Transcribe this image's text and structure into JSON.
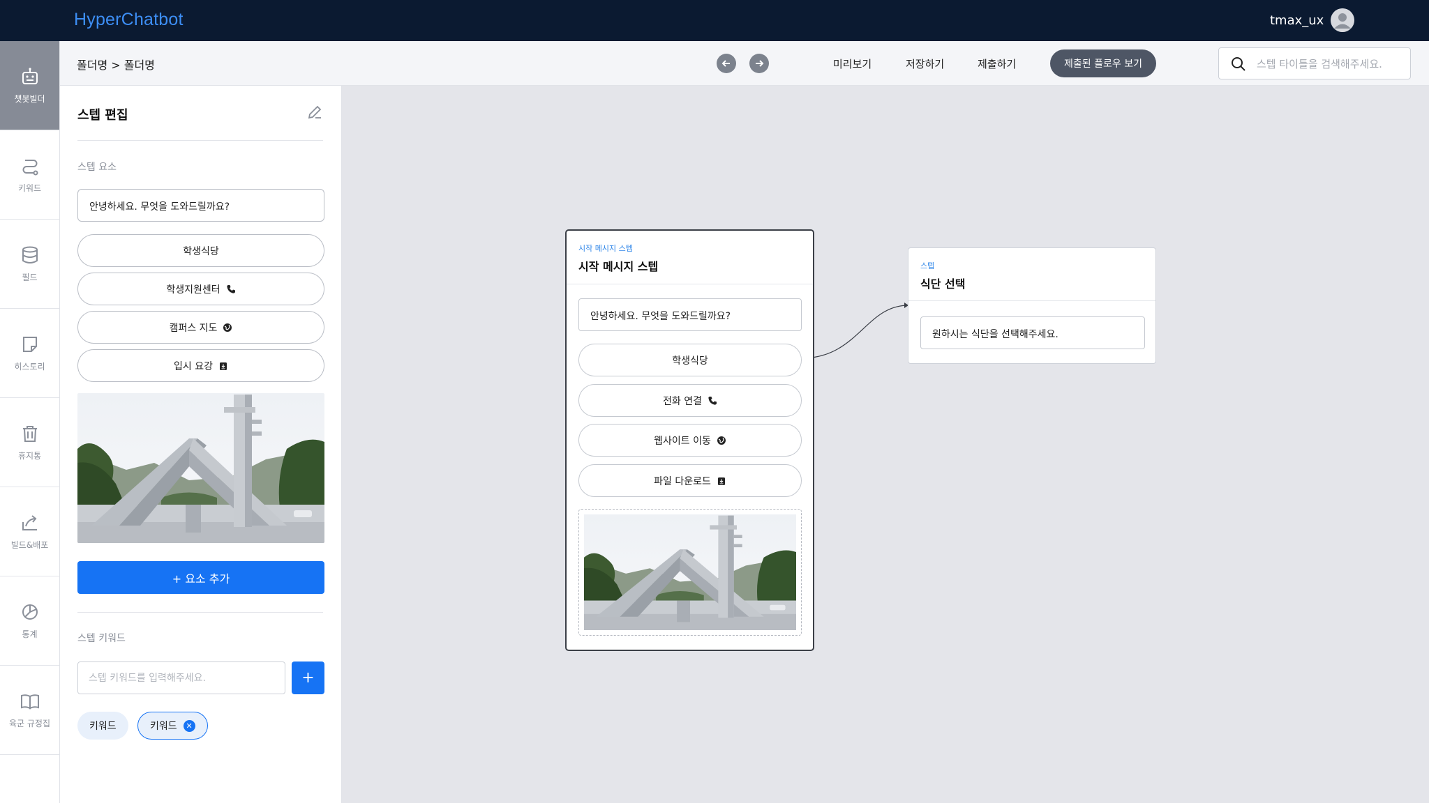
{
  "app": {
    "title": "HyperChatbot",
    "username": "tmax_ux"
  },
  "rail": {
    "items": [
      {
        "label": "챗봇빌더",
        "icon": "robot-icon",
        "active": true
      },
      {
        "label": "키워드",
        "icon": "route-icon",
        "active": false
      },
      {
        "label": "필드",
        "icon": "database-icon",
        "active": false
      },
      {
        "label": "히스토리",
        "icon": "note-icon",
        "active": false
      },
      {
        "label": "휴지통",
        "icon": "trash-icon",
        "active": false
      },
      {
        "label": "빌드&배포",
        "icon": "share-icon",
        "active": false
      },
      {
        "label": "통계",
        "icon": "pie-chart-icon",
        "active": false
      },
      {
        "label": "육군 규정집",
        "icon": "book-icon",
        "active": false
      }
    ]
  },
  "subheader": {
    "breadcrumb": "폴더명 > 폴더명",
    "preview": "미리보기",
    "save": "저장하기",
    "submit": "제출하기",
    "submitted_flow": "제출된 플로우 보기",
    "search_placeholder": "스텝 타이틀을 검색해주세요."
  },
  "editor": {
    "title": "스텝 편집",
    "elements_label": "스텝 요소",
    "text_element": "안녕하세요. 무엇을 도와드릴까요?",
    "buttons": [
      {
        "label": "학생식당",
        "icon": ""
      },
      {
        "label": "학생지원센터",
        "icon": "phone-icon"
      },
      {
        "label": "캠퍼스 지도",
        "icon": "globe-icon"
      },
      {
        "label": "입시 요강",
        "icon": "download-icon"
      }
    ],
    "add_element": "+ 요소 추가",
    "keywords_label": "스텝 키워드",
    "keyword_placeholder": "스텝 키워드를 입력해주세요.",
    "keyword_add": "+",
    "keywords": [
      {
        "label": "키워드",
        "selected": false
      },
      {
        "label": "키워드",
        "selected": true
      }
    ]
  },
  "canvas": {
    "start_card": {
      "tag": "시작 메시지 스텝",
      "title": "시작 메시지 스텝",
      "text": "안녕하세요. 무엇을 도와드릴까요?",
      "buttons": [
        {
          "label": "학생식당",
          "icon": ""
        },
        {
          "label": "전화 연결",
          "icon": "phone-icon"
        },
        {
          "label": "웹사이트 이동",
          "icon": "globe-icon"
        },
        {
          "label": "파일 다운로드",
          "icon": "download-icon"
        }
      ]
    },
    "next_card": {
      "tag": "스텝",
      "title": "식단 선택",
      "text": "원하시는 식단을 선택해주세요."
    }
  },
  "colors": {
    "topbar": "#0b1a31",
    "accent": "#1673f4",
    "logo": "#3d8ef5",
    "canvas": "#e4e5ea"
  }
}
